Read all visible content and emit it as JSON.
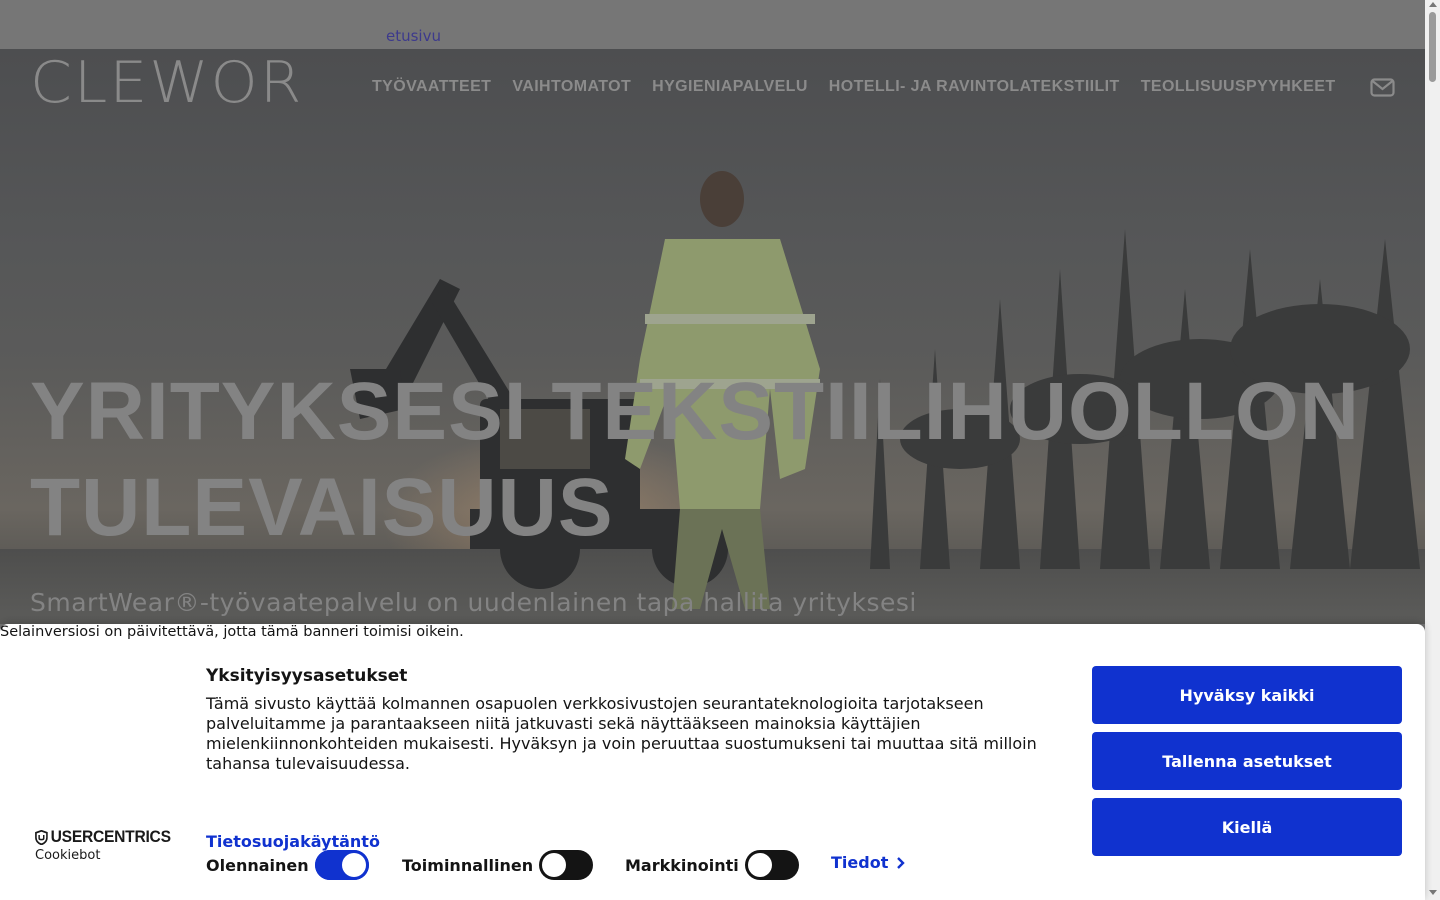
{
  "breadcrumb": {
    "label": "etusivu"
  },
  "brand": {
    "logo_text": "CLEWOR"
  },
  "nav": {
    "items": [
      {
        "label": "TYÖVAATTEET"
      },
      {
        "label": "VAIHTOMATOT"
      },
      {
        "label": "HYGIENIAPALVELU"
      },
      {
        "label": "HOTELLI- JA RAVINTOLATEKSTIILIT"
      },
      {
        "label": "TEOLLISUUSPYYHKEET"
      }
    ],
    "mail_icon": "mail-icon"
  },
  "hero": {
    "headline_line1": "YRITYKSESI TEKSTIILIHUOLLON",
    "headline_line2": "TULEVAISUUS",
    "subtitle": "SmartWear®-työvaatepalvelu on uudenlainen tapa hallita yrityksesi"
  },
  "cookie_banner": {
    "browser_notice": "Selainversiosi on päivitettävä, jotta tämä banneri toimisi oikein.",
    "title": "Yksityisyysasetukset",
    "body": "Tämä sivusto käyttää kolmannen osapuolen verkkosivustojen seurantateknologioita tarjotakseen palveluitamme ja parantaakseen niitä jatkuvasti sekä näyttääkseen mainoksia käyttäjien mielenkiinnonkohteiden mukaisesti. Hyväksyn ja voin peruuttaa suostumukseni tai muuttaa sitä milloin tahansa tulevaisuudessa.",
    "policy_link": "Tietosuojakäytäntö",
    "provider_brand": "USERCENTRICS",
    "provider_sub": "Cookiebot",
    "toggles": [
      {
        "label": "Olennainen",
        "state": "on"
      },
      {
        "label": "Toiminnallinen",
        "state": "off"
      },
      {
        "label": "Markkinointi",
        "state": "off"
      }
    ],
    "details_link": "Tiedot",
    "buttons": {
      "accept_all": "Hyväksy kaikki",
      "save_settings": "Tallenna asetukset",
      "deny": "Kiellä"
    },
    "accent_color": "#1032cf"
  }
}
